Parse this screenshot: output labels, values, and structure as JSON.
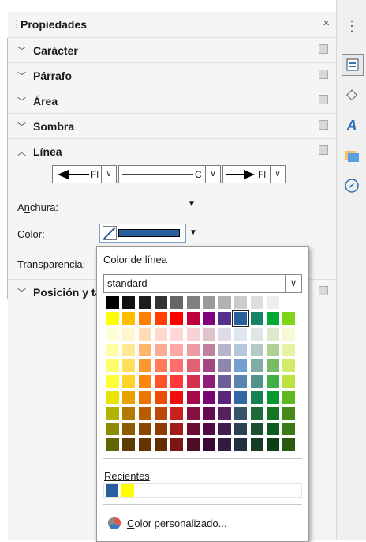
{
  "panel": {
    "title": "Propiedades",
    "close_glyph": "×",
    "sections": [
      {
        "label": "Carácter",
        "state": "collapsed"
      },
      {
        "label": "Párrafo",
        "state": "collapsed"
      },
      {
        "label": "Área",
        "state": "collapsed"
      },
      {
        "label": "Sombra",
        "state": "collapsed"
      },
      {
        "label": "Línea",
        "state": "expanded"
      }
    ],
    "line": {
      "start_arrow_text": "Fl",
      "end_arrow_text": "Fl",
      "style_text": "C",
      "width_label_pre": "A",
      "width_label_u": "n",
      "width_label_post": "chura:",
      "color_label_pre": "",
      "color_label_u": "C",
      "color_label_post": "olor:",
      "transparency_label_pre": "",
      "transparency_label_u": "T",
      "transparency_label_post": "ransparencia:",
      "color_value": "#2a5f9e"
    },
    "position_section_label": "Posición y ta"
  },
  "popup": {
    "title": "Color de línea",
    "palette": "standard",
    "recent_label": "Recientes",
    "recent_colors": [
      "#2a5f9e",
      "#ffff00"
    ],
    "custom_label_u": "C",
    "custom_label_post": "olor personalizado...",
    "selected_index": [
      1,
      8
    ],
    "palette_rows": [
      [
        "#000000",
        "#111111",
        "#1c1c1c",
        "#333333",
        "#666666",
        "#808080",
        "#999999",
        "#b2b2b2",
        "#cccccc",
        "#dddddd",
        "#eeeeee",
        "#ffffff"
      ],
      [
        "#ffff00",
        "#ffbf00",
        "#ff8000",
        "#ff4000",
        "#ff0000",
        "#bf0041",
        "#800080",
        "#55308d",
        "#2a6099",
        "#158466",
        "#00a933",
        "#81d41a"
      ],
      [
        "#ffffd7",
        "#fff5ce",
        "#ffdbb6",
        "#ffd8ce",
        "#ffd7d7",
        "#f7d1d5",
        "#e0c2cd",
        "#dedce6",
        "#dee6ef",
        "#dee7e5",
        "#dde8cb",
        "#f6f9d4"
      ],
      [
        "#ffffa6",
        "#ffe994",
        "#ffb66c",
        "#ffaa95",
        "#ffa6a6",
        "#ec9ba4",
        "#bf819e",
        "#b7b3ca",
        "#b4c7dc",
        "#b3cac7",
        "#afd095",
        "#e8f2a1"
      ],
      [
        "#ffff6d",
        "#ffde59",
        "#ff972f",
        "#ff7b59",
        "#ff6d6d",
        "#e16173",
        "#a1467e",
        "#8e86ae",
        "#729fcf",
        "#81aca6",
        "#77bc65",
        "#d4ea6b"
      ],
      [
        "#ffff38",
        "#ffd428",
        "#ff860d",
        "#ff5429",
        "#ff3838",
        "#d62e4e",
        "#8d1d75",
        "#6b5e9b",
        "#5983b0",
        "#50938a",
        "#3faf46",
        "#bbe33d"
      ],
      [
        "#e6e600",
        "#e8a202",
        "#ea7500",
        "#ed4c05",
        "#f10d0c",
        "#a7074b",
        "#780373",
        "#5b277d",
        "#3465a4",
        "#168253",
        "#069a2e",
        "#5eb91e"
      ],
      [
        "#b2b200",
        "#b47804",
        "#b85c00",
        "#be480a",
        "#c9211e",
        "#861141",
        "#650953",
        "#55215b",
        "#355269",
        "#1e6a39",
        "#127622",
        "#468a1a"
      ],
      [
        "#8c8c00",
        "#8c5b06",
        "#8a4600",
        "#8e3c00",
        "#a31c1a",
        "#6e0d33",
        "#520a43",
        "#431c50",
        "#2d4153",
        "#1d4f33",
        "#0c5b1e",
        "#3b7a16"
      ],
      [
        "#646400",
        "#5a3c04",
        "#653300",
        "#632e00",
        "#7d1513",
        "#4e0d26",
        "#3b0735",
        "#321a40",
        "#21313d",
        "#163b27",
        "#0b3f16",
        "#2a5a11"
      ]
    ]
  },
  "sidebar": {
    "icons": [
      "more-icon",
      "properties-icon",
      "styles-icon",
      "fontwork-icon",
      "gallery-icon",
      "navigator-icon"
    ]
  }
}
